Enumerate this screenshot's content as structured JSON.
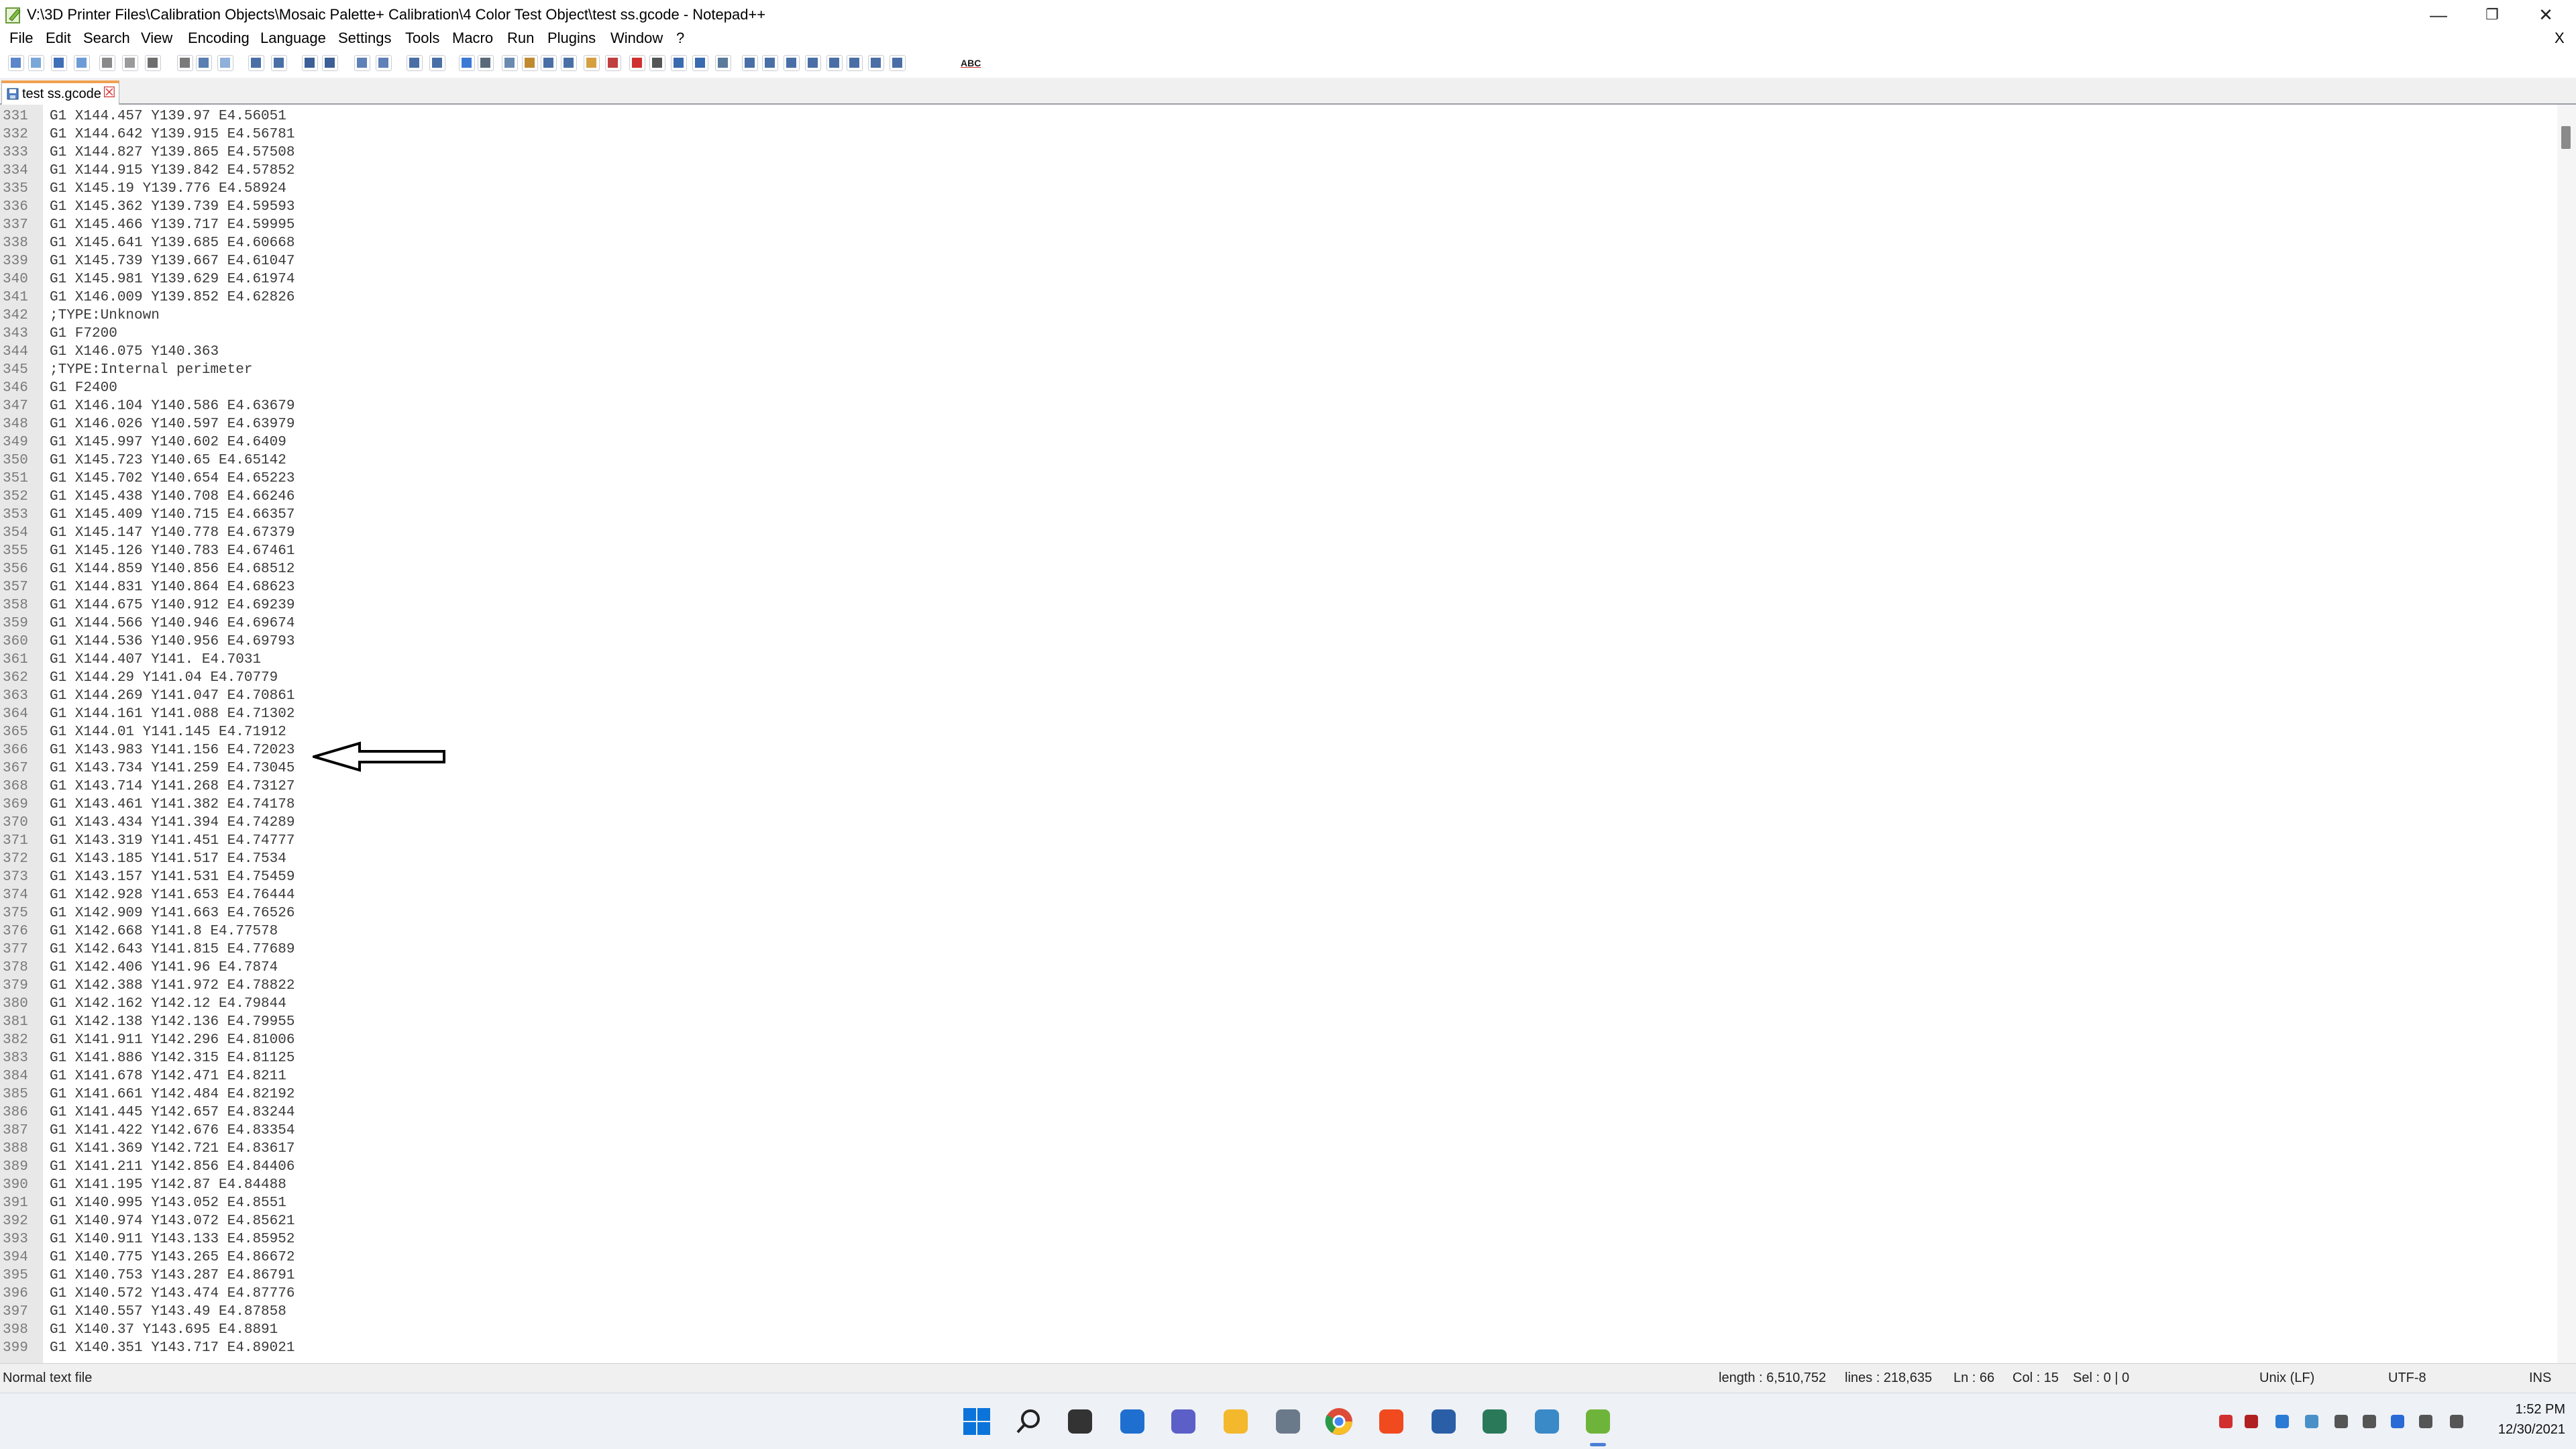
{
  "window": {
    "title": "V:\\3D Printer Files\\Calibration Objects\\Mosaic Palette+ Calibration\\4 Color Test Object\\test ss.gcode - Notepad++",
    "minimize_glyph": "—",
    "maximize_glyph": "❐",
    "close_glyph": "✕"
  },
  "menu": {
    "items": [
      "File",
      "Edit",
      "Search",
      "View",
      "Encoding",
      "Language",
      "Settings",
      "Tools",
      "Macro",
      "Run",
      "Plugins",
      "Window",
      "?"
    ],
    "close_doc_glyph": "X"
  },
  "toolbar": {
    "icons": [
      "new-file-icon",
      "open-file-icon",
      "save-icon",
      "save-all-icon",
      "close-icon",
      "close-all-icon",
      "print-icon",
      "cut-icon",
      "copy-icon",
      "paste-icon",
      "undo-icon",
      "redo-icon",
      "find-icon",
      "replace-icon",
      "zoom-in-icon",
      "zoom-out-icon",
      "sync-vertical-icon",
      "sync-horizontal-icon",
      "word-wrap-icon",
      "show-all-chars-icon",
      "indent-guide-icon",
      "user-defined-lang-icon",
      "doc-map-icon",
      "function-list-icon",
      "folder-workspace-icon",
      "monitoring-icon",
      "record-macro-icon",
      "stop-macro-icon",
      "play-macro-icon",
      "run-macro-multiple-icon",
      "save-macro-icon",
      "plugin-a-icon",
      "plugin-b-icon",
      "plugin-c-icon",
      "plugin-d-icon",
      "plugin-e-icon",
      "plugin-f-icon",
      "plugin-g-icon",
      "plugin-h-icon",
      "spell-check-icon"
    ],
    "spell_label": "ABC"
  },
  "tab": {
    "label": "test ss.gcode",
    "close_glyph": "☒"
  },
  "editor": {
    "lines": [
      [
        "331",
        "G1 X144.457 Y139.97 E4.56051"
      ],
      [
        "332",
        "G1 X144.642 Y139.915 E4.56781"
      ],
      [
        "333",
        "G1 X144.827 Y139.865 E4.57508"
      ],
      [
        "334",
        "G1 X144.915 Y139.842 E4.57852"
      ],
      [
        "335",
        "G1 X145.19 Y139.776 E4.58924"
      ],
      [
        "336",
        "G1 X145.362 Y139.739 E4.59593"
      ],
      [
        "337",
        "G1 X145.466 Y139.717 E4.59995"
      ],
      [
        "338",
        "G1 X145.641 Y139.685 E4.60668"
      ],
      [
        "339",
        "G1 X145.739 Y139.667 E4.61047"
      ],
      [
        "340",
        "G1 X145.981 Y139.629 E4.61974"
      ],
      [
        "341",
        "G1 X146.009 Y139.852 E4.62826"
      ],
      [
        "342",
        ";TYPE:Unknown"
      ],
      [
        "343",
        "G1 F7200"
      ],
      [
        "344",
        "G1 X146.075 Y140.363"
      ],
      [
        "345",
        ";TYPE:Internal perimeter"
      ],
      [
        "346",
        "G1 F2400"
      ],
      [
        "347",
        "G1 X146.104 Y140.586 E4.63679"
      ],
      [
        "348",
        "G1 X146.026 Y140.597 E4.63979"
      ],
      [
        "349",
        "G1 X145.997 Y140.602 E4.6409"
      ],
      [
        "350",
        "G1 X145.723 Y140.65 E4.65142"
      ],
      [
        "351",
        "G1 X145.702 Y140.654 E4.65223"
      ],
      [
        "352",
        "G1 X145.438 Y140.708 E4.66246"
      ],
      [
        "353",
        "G1 X145.409 Y140.715 E4.66357"
      ],
      [
        "354",
        "G1 X145.147 Y140.778 E4.67379"
      ],
      [
        "355",
        "G1 X145.126 Y140.783 E4.67461"
      ],
      [
        "356",
        "G1 X144.859 Y140.856 E4.68512"
      ],
      [
        "357",
        "G1 X144.831 Y140.864 E4.68623"
      ],
      [
        "358",
        "G1 X144.675 Y140.912 E4.69239"
      ],
      [
        "359",
        "G1 X144.566 Y140.946 E4.69674"
      ],
      [
        "360",
        "G1 X144.536 Y140.956 E4.69793"
      ],
      [
        "361",
        "G1 X144.407 Y141. E4.7031"
      ],
      [
        "362",
        "G1 X144.29 Y141.04 E4.70779"
      ],
      [
        "363",
        "G1 X144.269 Y141.047 E4.70861"
      ],
      [
        "364",
        "G1 X144.161 Y141.088 E4.71302"
      ],
      [
        "365",
        "G1 X144.01 Y141.145 E4.71912"
      ],
      [
        "366",
        "G1 X143.983 Y141.156 E4.72023"
      ],
      [
        "367",
        "G1 X143.734 Y141.259 E4.73045"
      ],
      [
        "368",
        "G1 X143.714 Y141.268 E4.73127"
      ],
      [
        "369",
        "G1 X143.461 Y141.382 E4.74178"
      ],
      [
        "370",
        "G1 X143.434 Y141.394 E4.74289"
      ],
      [
        "371",
        "G1 X143.319 Y141.451 E4.74777"
      ],
      [
        "372",
        "G1 X143.185 Y141.517 E4.7534"
      ],
      [
        "373",
        "G1 X143.157 Y141.531 E4.75459"
      ],
      [
        "374",
        "G1 X142.928 Y141.653 E4.76444"
      ],
      [
        "375",
        "G1 X142.909 Y141.663 E4.76526"
      ],
      [
        "376",
        "G1 X142.668 Y141.8 E4.77578"
      ],
      [
        "377",
        "G1 X142.643 Y141.815 E4.77689"
      ],
      [
        "378",
        "G1 X142.406 Y141.96 E4.7874"
      ],
      [
        "379",
        "G1 X142.388 Y141.972 E4.78822"
      ],
      [
        "380",
        "G1 X142.162 Y142.12 E4.79844"
      ],
      [
        "381",
        "G1 X142.138 Y142.136 E4.79955"
      ],
      [
        "382",
        "G1 X141.911 Y142.296 E4.81006"
      ],
      [
        "383",
        "G1 X141.886 Y142.315 E4.81125"
      ],
      [
        "384",
        "G1 X141.678 Y142.471 E4.8211"
      ],
      [
        "385",
        "G1 X141.661 Y142.484 E4.82192"
      ],
      [
        "386",
        "G1 X141.445 Y142.657 E4.83244"
      ],
      [
        "387",
        "G1 X141.422 Y142.676 E4.83354"
      ],
      [
        "388",
        "G1 X141.369 Y142.721 E4.83617"
      ],
      [
        "389",
        "G1 X141.211 Y142.856 E4.84406"
      ],
      [
        "390",
        "G1 X141.195 Y142.87 E4.84488"
      ],
      [
        "391",
        "G1 X140.995 Y143.052 E4.8551"
      ],
      [
        "392",
        "G1 X140.974 Y143.072 E4.85621"
      ],
      [
        "393",
        "G1 X140.911 Y143.133 E4.85952"
      ],
      [
        "394",
        "G1 X140.775 Y143.265 E4.86672"
      ],
      [
        "395",
        "G1 X140.753 Y143.287 E4.86791"
      ],
      [
        "396",
        "G1 X140.572 Y143.474 E4.87776"
      ],
      [
        "397",
        "G1 X140.557 Y143.49 E4.87858"
      ],
      [
        "398",
        "G1 X140.37 Y143.695 E4.8891"
      ],
      [
        "399",
        "G1 X140.351 Y143.717 E4.89021"
      ]
    ]
  },
  "statusbar": {
    "file_type": "Normal text file",
    "length": "length : 6,510,752",
    "lines": "lines : 218,635",
    "ln": "Ln : 66",
    "col": "Col : 15",
    "sel": "Sel : 0 | 0",
    "eol": "Unix (LF)",
    "encoding": "UTF-8",
    "mode": "INS"
  },
  "taskbar": {
    "apps": [
      "windows-start-icon",
      "search-icon",
      "task-view-icon",
      "widgets-icon",
      "chat-icon",
      "file-explorer-icon",
      "camera-icon",
      "chrome-icon",
      "brave-icon",
      "app-blue-icon",
      "app-green-icon",
      "app-globe-icon",
      "notepadpp-icon"
    ],
    "active_app": "notepadpp-icon",
    "tray": [
      "red-app-icon",
      "zotero-icon",
      "tray-globe-icon",
      "network-cloud-icon",
      "volume-icon",
      "battery-icon",
      "bluetooth-icon",
      "display-icon",
      "speaker-icon"
    ],
    "time": "1:52 PM",
    "date": "12/30/2021"
  }
}
